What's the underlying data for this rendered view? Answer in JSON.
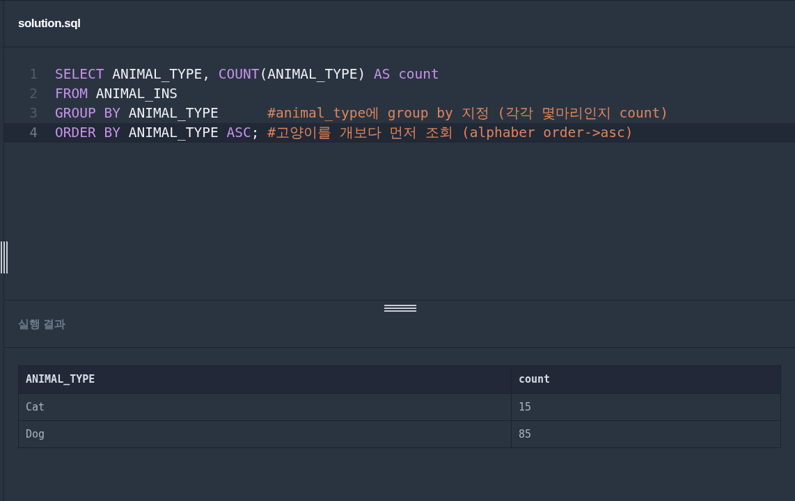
{
  "file_tab": {
    "title": "solution.sql"
  },
  "editor": {
    "lines": [
      {
        "number": "1",
        "current": false,
        "tokens": [
          {
            "kind": "keyword",
            "text": "SELECT"
          },
          {
            "kind": "plain",
            "text": " ANIMAL_TYPE, "
          },
          {
            "kind": "function",
            "text": "COUNT"
          },
          {
            "kind": "plain",
            "text": "(ANIMAL_TYPE) "
          },
          {
            "kind": "keyword",
            "text": "AS count"
          }
        ]
      },
      {
        "number": "2",
        "current": false,
        "tokens": [
          {
            "kind": "keyword",
            "text": "FROM"
          },
          {
            "kind": "plain",
            "text": " ANIMAL_INS"
          }
        ]
      },
      {
        "number": "3",
        "current": false,
        "tokens": [
          {
            "kind": "keyword",
            "text": "GROUP BY"
          },
          {
            "kind": "plain",
            "text": " ANIMAL_TYPE      "
          },
          {
            "kind": "comment",
            "text": "#animal_type에 group by 지정 (각각 몇마리인지 count)"
          }
        ]
      },
      {
        "number": "4",
        "current": true,
        "tokens": [
          {
            "kind": "keyword",
            "text": "ORDER BY"
          },
          {
            "kind": "plain",
            "text": " ANIMAL_TYPE "
          },
          {
            "kind": "keyword",
            "text": "ASC"
          },
          {
            "kind": "plain",
            "text": "; "
          },
          {
            "kind": "comment",
            "text": "#고양이를 개보다 먼저 조회 (alphaber order->asc)"
          }
        ]
      }
    ]
  },
  "results": {
    "title": "실행 결과",
    "table": {
      "columns": [
        "ANIMAL_TYPE",
        "count"
      ],
      "rows": [
        [
          "Cat",
          "15"
        ],
        [
          "Dog",
          "85"
        ]
      ]
    }
  }
}
